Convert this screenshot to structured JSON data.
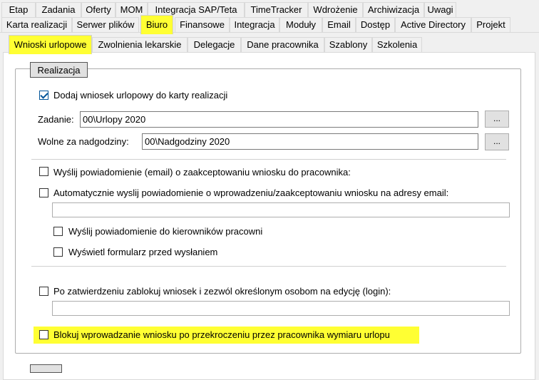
{
  "tabs_row1": [
    "Etap",
    "Zadania",
    "Oferty",
    "MOM",
    "Integracja SAP/Teta",
    "TimeTracker",
    "Wdrożenie",
    "Archiwizacja",
    "Uwagi"
  ],
  "tabs_row2": [
    "Karta realizacji",
    "Serwer plików",
    "Biuro",
    "Finansowe",
    "Integracja",
    "Moduły",
    "Email",
    "Dostęp",
    "Active Directory",
    "Projekt"
  ],
  "tabs_row3": [
    "Wnioski urlopowe",
    "Zwolnienia lekarskie",
    "Delegacje",
    "Dane pracownika",
    "Szablony",
    "Szkolenia"
  ],
  "group_title": "Realizacja",
  "add_to_card": {
    "label": "Dodaj wniosek urlopowy do karty realizacji",
    "checked": true
  },
  "task": {
    "label": "Zadanie:",
    "value": "00\\Urlopy 2020",
    "browse": "..."
  },
  "overtime": {
    "label": "Wolne za nadgodziny:",
    "value": "00\\Nadgodziny 2020",
    "browse": "..."
  },
  "notify_employee": {
    "label": "Wyślij powiadomienie (email) o zaakceptowaniu wniosku do pracownika:",
    "checked": false
  },
  "auto_notify": {
    "label": "Automatycznie wyslij powiadomienie o wprowadzeniu/zaakceptowaniu wniosku na adresy email:",
    "checked": false,
    "value": ""
  },
  "notify_managers": {
    "label": "Wyślij powiadomienie do kierowników pracowni",
    "checked": false
  },
  "show_form": {
    "label": "Wyświetl formularz przed wysłaniem",
    "checked": false
  },
  "lock_request": {
    "label": "Po zatwierdzeniu zablokuj wniosek i zezwól określonym osobom na edycję (login):",
    "checked": false,
    "value": ""
  },
  "block_over_limit": {
    "label": "Blokuj wprowadzanie wniosku po przekroczeniu przez pracownika wymiaru urlopu",
    "checked": false
  },
  "highlight_color": "#ffff33",
  "checkbox_color": "#005499"
}
